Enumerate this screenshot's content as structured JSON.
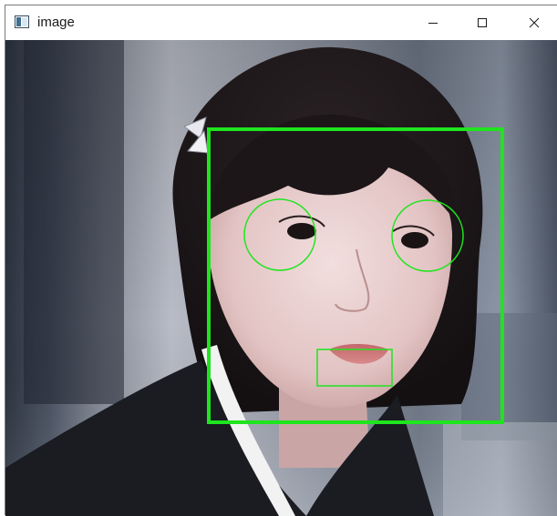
{
  "window": {
    "title": "image",
    "controls": {
      "minimize_icon": "minimize-icon",
      "maximize_icon": "maximize-icon",
      "close_icon": "close-icon"
    }
  },
  "image_content": {
    "description_icon": "photo-image",
    "detection_color": "#1ee51e"
  }
}
